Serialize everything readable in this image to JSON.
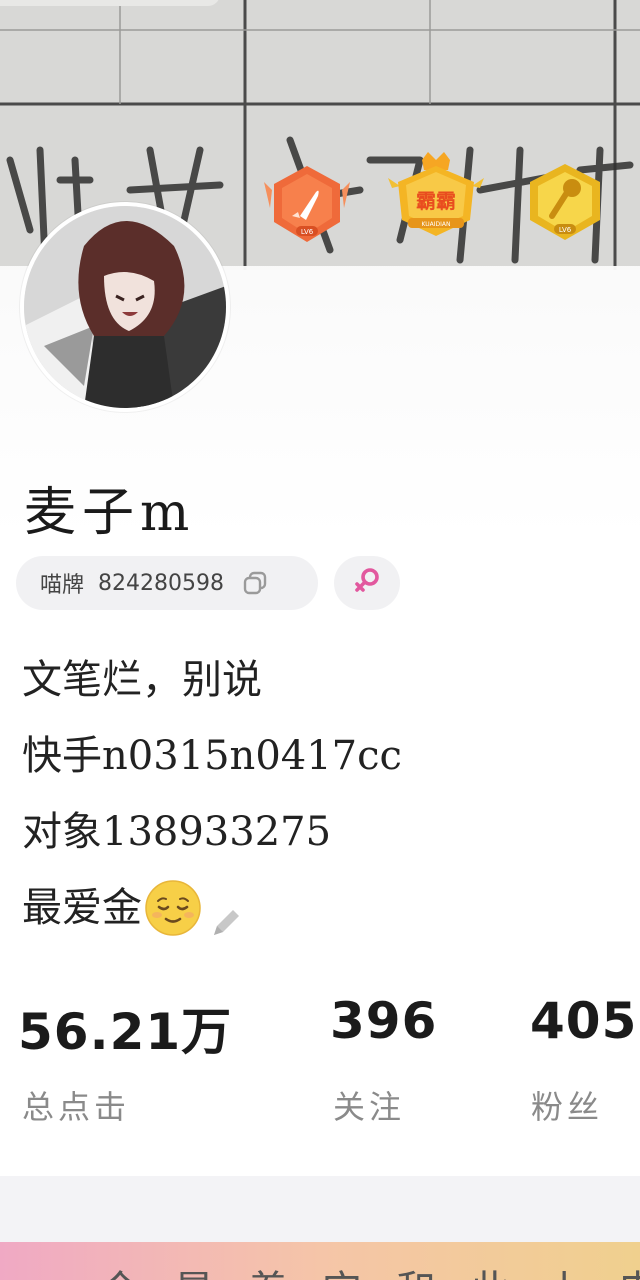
{
  "profile": {
    "name": "麦子m",
    "id_label": "喵牌",
    "id_value": "824280598",
    "bio_lines": [
      "文笔烂，别说",
      "快手n0315n0417cc",
      "对象138933275",
      "最爱金"
    ]
  },
  "badges": [
    {
      "icon": "rocket-badge-icon",
      "label": "LV6"
    },
    {
      "icon": "crown-badge-icon",
      "label": "霸霸",
      "sub": "KUAIDIAN"
    },
    {
      "icon": "microphone-badge-icon",
      "label": "LV6"
    }
  ],
  "stats": [
    {
      "value": "56.21万",
      "label": "总点击"
    },
    {
      "value": "396",
      "label": "关注"
    },
    {
      "value": "405",
      "label": "粉丝"
    }
  ],
  "footer": {
    "partial_text": "今是着它和此小电中天"
  },
  "colors": {
    "female_symbol": "#e2589e",
    "badge_orange": "#ef6a3a",
    "badge_gold": "#f0b81f"
  }
}
